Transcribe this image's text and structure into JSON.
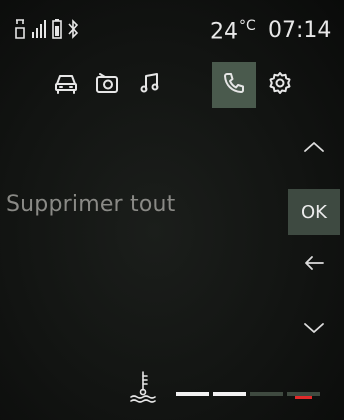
{
  "status": {
    "temperature_value": "24",
    "temperature_unit": "°C",
    "clock": "07:14",
    "icons": [
      "phone-handset-icon",
      "signal-bars-icon",
      "battery-icon",
      "bluetooth-icon"
    ]
  },
  "tabs": [
    {
      "icon": "car-icon",
      "active": false
    },
    {
      "icon": "radio-icon",
      "active": false
    },
    {
      "icon": "music-note-icon",
      "active": false
    },
    {
      "icon": "phone-icon",
      "active": true
    },
    {
      "icon": "gear-icon",
      "active": false
    }
  ],
  "main": {
    "text": "Supprimer tout"
  },
  "controls": {
    "up_icon": "chevron-up-icon",
    "ok_label": "OK",
    "back_icon": "arrow-left-icon",
    "down_icon": "chevron-down-icon"
  },
  "gauge": {
    "icon": "coolant-temperature-icon",
    "segments_total": 4,
    "segments_lit": 2,
    "colors": {
      "lit": "#f2f2f2",
      "unlit": "#3f4a40",
      "warning": "#e02a2a"
    }
  }
}
